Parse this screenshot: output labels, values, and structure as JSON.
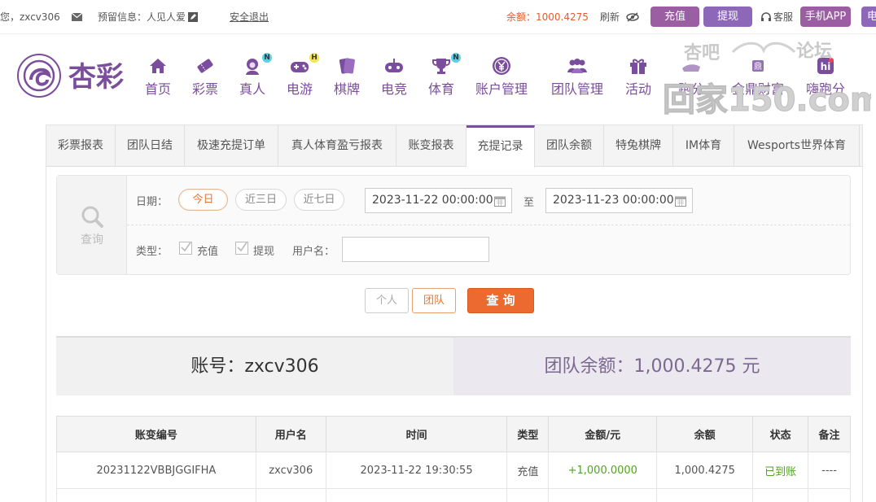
{
  "topbar": {
    "greeting": "您，zxcv306",
    "reserved_label": "预留信息：人见人爱",
    "logout": "安全退出",
    "balance": "余额：1000.4275",
    "refresh": "刷新",
    "recharge": "充值",
    "withdraw": "提现",
    "service": "客服",
    "app": "手机APP",
    "edge_label": "电"
  },
  "logo_text": "杏彩",
  "nav": [
    {
      "label": "首页",
      "icon": "home-icon"
    },
    {
      "label": "彩票",
      "icon": "lottery-ticket-icon"
    },
    {
      "label": "真人",
      "icon": "live-dealer-icon",
      "badge": "N"
    },
    {
      "label": "电游",
      "icon": "gamepad-icon",
      "badge": "H"
    },
    {
      "label": "棋牌",
      "icon": "cards-icon"
    },
    {
      "label": "电竞",
      "icon": "esports-controller-icon"
    },
    {
      "label": "体育",
      "icon": "trophy-icon",
      "badge": "N"
    },
    {
      "label": "账户管理",
      "icon": "yen-coin-icon"
    },
    {
      "label": "团队管理",
      "icon": "team-icon"
    },
    {
      "label": "活动",
      "icon": "gift-icon"
    },
    {
      "label": "跑分",
      "icon": "run-score-icon"
    },
    {
      "label": "金鼎财富",
      "icon": "wealth-icon"
    },
    {
      "label": "嗨跑分",
      "icon": "hi-icon"
    }
  ],
  "watermark": {
    "line1": "杏吧",
    "line2": "论坛",
    "line3": "回家150.com"
  },
  "tabs": [
    "彩票报表",
    "团队日结",
    "极速充提订单",
    "真人体育盈亏报表",
    "账变报表",
    "充提记录",
    "团队余额",
    "特兔棋牌",
    "IM体育",
    "Wesports世界体育"
  ],
  "active_tab": "充提记录",
  "filter": {
    "query_label": "查询",
    "date_label": "日期：",
    "pills": [
      "今日",
      "近三日",
      "近七日"
    ],
    "date_from": "2023-11-22 00:00:00",
    "to_label": "至",
    "date_to": "2023-11-23 00:00:00",
    "type_label": "类型：",
    "type_options": [
      "充值",
      "提现"
    ],
    "username_label": "用户名：",
    "username_value": ""
  },
  "buttons": {
    "personal": "个人",
    "team": "团队",
    "query": "查 询"
  },
  "summary": {
    "account": "账号：zxcv306",
    "team_balance": "团队余额：1,000.4275 元"
  },
  "table": {
    "headers": [
      "账变编号",
      "用户名",
      "时间",
      "类型",
      "金额/元",
      "余额",
      "状态",
      "备注"
    ],
    "rows": [
      [
        "20231122VBBJGGIFHA",
        "zxcv306",
        "2023-11-22 19:30:55",
        "充值",
        "+1,000.0000",
        "1,000.4275",
        "已到账",
        "----"
      ]
    ]
  },
  "colors": {
    "purple": "#7a4d9d",
    "orange": "#e8782e",
    "green": "#52a31e",
    "balance_red": "#e55b2b"
  }
}
